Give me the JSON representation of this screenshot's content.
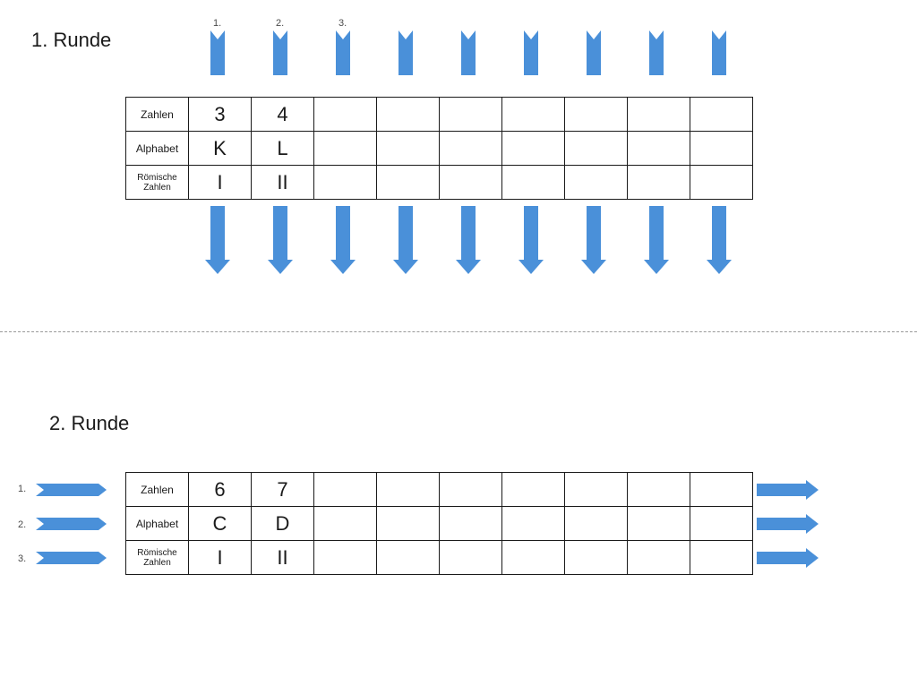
{
  "round1": {
    "title": "1. Runde",
    "topNumbers": [
      "1.",
      "2.",
      "3."
    ],
    "rows": [
      {
        "header": "Zahlen",
        "cells": [
          "3",
          "4",
          "",
          "",
          "",
          "",
          "",
          "",
          ""
        ]
      },
      {
        "header": "Alphabet",
        "cells": [
          "K",
          "L",
          "",
          "",
          "",
          "",
          "",
          "",
          ""
        ]
      },
      {
        "header": "Römische\nZahlen",
        "cells": [
          "I",
          "II",
          "",
          "",
          "",
          "",
          "",
          "",
          ""
        ]
      }
    ]
  },
  "round2": {
    "title": "2. Runde",
    "leftNumbers": [
      "1.",
      "2.",
      "3."
    ],
    "rows": [
      {
        "header": "Zahlen",
        "cells": [
          "6",
          "7",
          "",
          "",
          "",
          "",
          "",
          "",
          ""
        ]
      },
      {
        "header": "Alphabet",
        "cells": [
          "C",
          "D",
          "",
          "",
          "",
          "",
          "",
          "",
          ""
        ]
      },
      {
        "header": "Römische\nZahlen",
        "cells": [
          "I",
          "II",
          "",
          "",
          "",
          "",
          "",
          "",
          ""
        ]
      }
    ]
  },
  "layout": {
    "tableLeft": 140,
    "col0Width": 70,
    "cellWidth": 70,
    "round1TableTop": 108,
    "round2TableTop": 527,
    "arrowColor": "#4a90d9"
  }
}
